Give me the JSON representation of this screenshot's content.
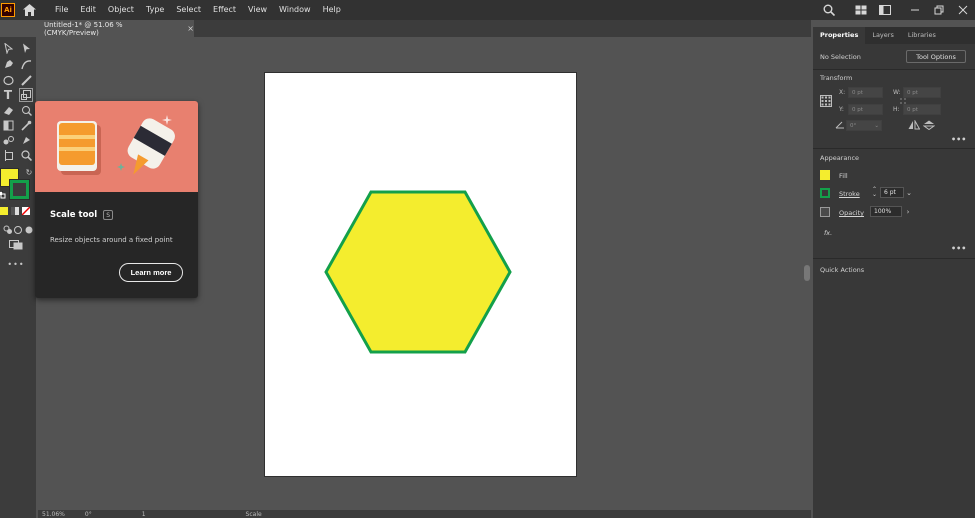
{
  "app": {
    "logo_text": "Ai"
  },
  "menu": [
    "File",
    "Edit",
    "Object",
    "Type",
    "Select",
    "Effect",
    "View",
    "Window",
    "Help"
  ],
  "document_tab": {
    "title": "Untitled-1* @ 51.06 % (CMYK/Preview)",
    "close": "×"
  },
  "tooltip": {
    "title": "Scale tool",
    "shortcut": "S",
    "description": "Resize objects around a fixed point",
    "button": "Learn more"
  },
  "panel": {
    "tabs": [
      "Properties",
      "Layers",
      "Libraries"
    ],
    "selection": "No Selection",
    "tool_options": "Tool Options",
    "transform_title": "Transform",
    "x_label": "X:",
    "y_label": "Y:",
    "w_label": "W:",
    "h_label": "H:",
    "x_value": "0 pt",
    "y_value": "0 pt",
    "w_value": "0 pt",
    "h_value": "0 pt",
    "angle_value": "0°",
    "more": "•••",
    "appearance_title": "Appearance",
    "fill_label": "Fill",
    "stroke_label": "Stroke",
    "stroke_value": "6 pt",
    "opacity_label": "Opacity",
    "opacity_value": "100%",
    "fx_label": "fx.",
    "quick_actions_title": "Quick Actions"
  },
  "status": {
    "zoom": "51.06%",
    "rotation": "0°",
    "artboard": "1",
    "tool": "Scale"
  },
  "colors": {
    "fill": "#f4ed2e",
    "stroke": "#13a04a",
    "tooltip_illustration": "#e8806f"
  }
}
